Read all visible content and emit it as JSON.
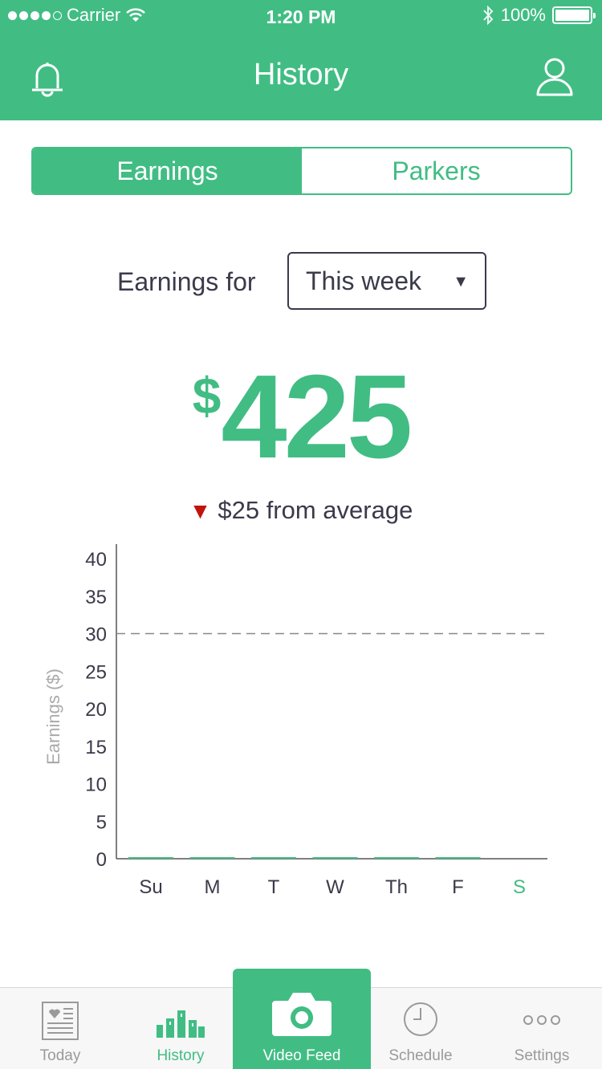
{
  "status_bar": {
    "carrier": "Carrier",
    "time": "1:20 PM",
    "battery": "100%"
  },
  "header": {
    "title": "History",
    "left_icon": "bell-icon",
    "right_icon": "user-icon"
  },
  "segment": {
    "tabs": [
      {
        "label": "Earnings",
        "active": true
      },
      {
        "label": "Parkers",
        "active": false
      }
    ]
  },
  "filter": {
    "label": "Earnings for",
    "selected": "This week"
  },
  "summary": {
    "currency": "$",
    "amount": "425",
    "delta_text": "$25 from average",
    "delta_direction": "down",
    "delta_color": "#c0140c"
  },
  "chart_data": {
    "type": "bar",
    "categories": [
      "Su",
      "M",
      "T",
      "W",
      "Th",
      "F",
      "S"
    ],
    "values": [
      0,
      0,
      0,
      0,
      0,
      0,
      null
    ],
    "highlight_category": "S",
    "ylabel": "Earnings ($)",
    "ylim": [
      0,
      40
    ],
    "yticks": [
      0,
      5,
      10,
      15,
      20,
      25,
      30,
      35,
      40
    ],
    "reference_line": 30,
    "grid": false,
    "bar_color": "#41bd84"
  },
  "tabbar": {
    "items": [
      {
        "label": "Today",
        "icon": "newspaper-icon",
        "active": false
      },
      {
        "label": "History",
        "icon": "bar-chart-icon",
        "active": true
      },
      {
        "label": "Video Feed",
        "icon": "camera-icon",
        "active": false
      },
      {
        "label": "Schedule",
        "icon": "clock-icon",
        "active": false
      },
      {
        "label": "Settings",
        "icon": "more-dots-icon",
        "active": false
      }
    ]
  },
  "colors": {
    "brand": "#41bd84",
    "text": "#3a3a4a",
    "muted": "#9a9a9a"
  }
}
